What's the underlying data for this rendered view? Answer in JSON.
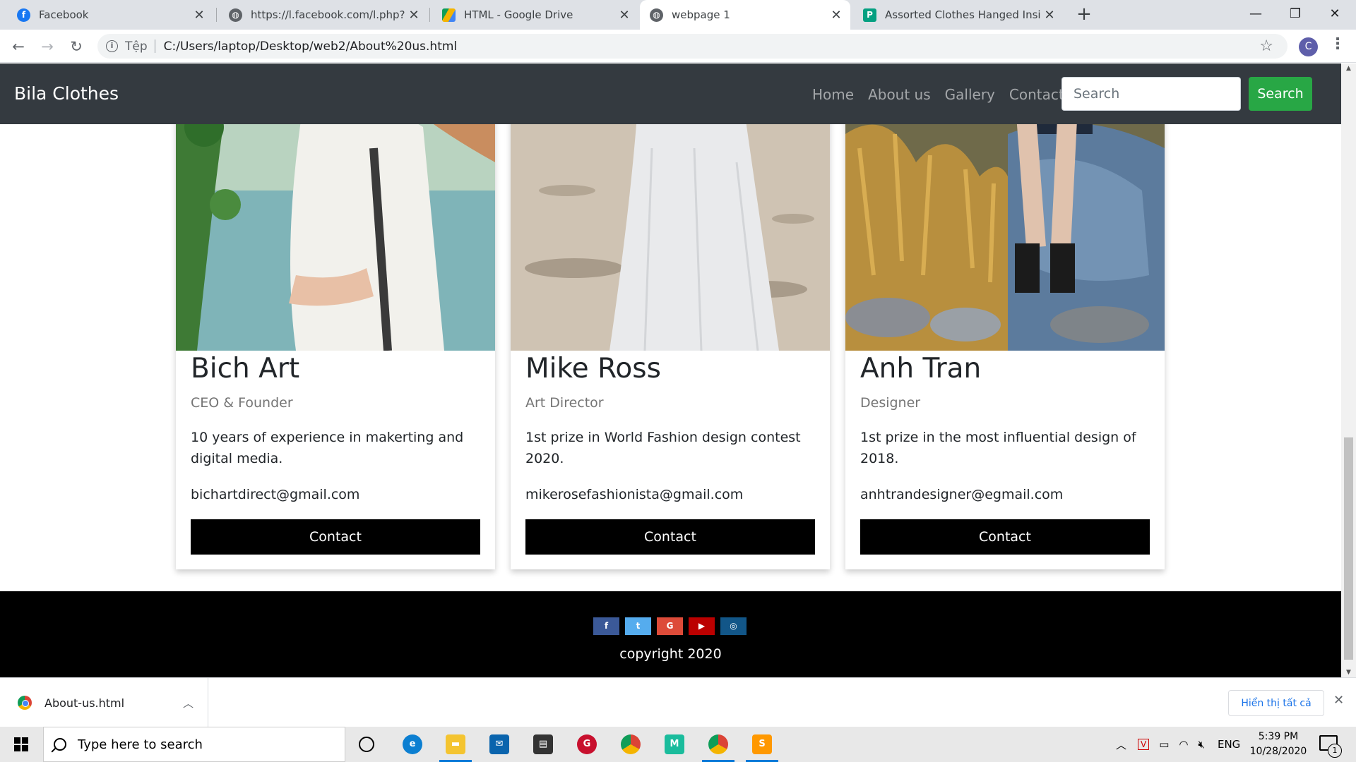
{
  "browser": {
    "tabs": [
      {
        "title": "Facebook",
        "icon": "facebook-icon",
        "color": "#1877f2",
        "active": false
      },
      {
        "title": "https://l.facebook.com/l.php?u=h",
        "icon": "globe-icon",
        "color": "#5f6368",
        "active": false
      },
      {
        "title": "HTML - Google Drive",
        "icon": "google-drive-icon",
        "color": "#0f9d58",
        "active": false
      },
      {
        "title": "webpage 1",
        "icon": "globe-icon",
        "color": "#5f6368",
        "active": true
      },
      {
        "title": "Assorted Clothes Hanged Inside C",
        "icon": "pexels-icon",
        "color": "#05a081",
        "active": false
      }
    ],
    "address": {
      "scheme_label": "Tệp",
      "url": "C:/Users/laptop/Desktop/web2/About%20us.html"
    },
    "profile_initial": "C"
  },
  "site": {
    "brand": "Bila Clothes",
    "nav": [
      "Home",
      "About us",
      "Gallery",
      "Contact"
    ],
    "search_placeholder": "Search",
    "search_button": "Search"
  },
  "team": [
    {
      "name": "Bich Art",
      "role": "CEO & Founder",
      "desc": "10 years of experience in makerting and digital media.",
      "email": "bichartdirect@gmail.com",
      "button": "Contact"
    },
    {
      "name": "Mike Ross",
      "role": "Art Director",
      "desc": "1st prize in World Fashion design contest 2020.",
      "email": "mikerosefashionista@gmail.com",
      "button": "Contact"
    },
    {
      "name": "Anh Tran",
      "role": "Designer",
      "desc": "1st prize in the most influential design of 2018.",
      "email": "anhtrandesigner@egmail.com",
      "button": "Contact"
    }
  ],
  "footer": {
    "socials": [
      {
        "icon": "facebook-icon",
        "glyph": "f",
        "color": "#3b5998"
      },
      {
        "icon": "twitter-icon",
        "glyph": "t",
        "color": "#55acee"
      },
      {
        "icon": "google-icon",
        "glyph": "G",
        "color": "#dd4b39"
      },
      {
        "icon": "youtube-icon",
        "glyph": "▶",
        "color": "#bb0000"
      },
      {
        "icon": "instagram-icon",
        "glyph": "◎",
        "color": "#125688"
      }
    ],
    "copyright": "copyright 2020"
  },
  "downloads": {
    "file": "About-us.html",
    "show_all": "Hiển thị tất cả"
  },
  "taskbar": {
    "search_placeholder": "Type here to search",
    "language": "ENG",
    "time": "5:39 PM",
    "date": "10/28/2020",
    "notification_count": "1"
  },
  "colors": {
    "navbar": "#343a40",
    "search_button": "#28a745",
    "footer": "#000000"
  }
}
